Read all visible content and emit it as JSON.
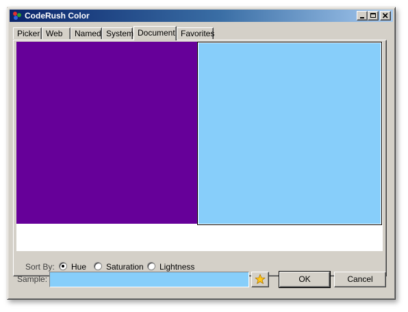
{
  "window": {
    "title": "CodeRush Color"
  },
  "tabs": [
    {
      "label": "Picker",
      "active": false
    },
    {
      "label": "Web",
      "active": false
    },
    {
      "label": "Named",
      "active": false
    },
    {
      "label": "System",
      "active": false
    },
    {
      "label": "Document",
      "active": true
    },
    {
      "label": "Favorites",
      "active": false
    }
  ],
  "swatches": [
    {
      "color": "#660099",
      "selected": false
    },
    {
      "color": "#87cefa",
      "selected": true
    }
  ],
  "sort": {
    "label": "Sort By:",
    "options": [
      {
        "label": "Hue",
        "checked": true
      },
      {
        "label": "Saturation",
        "checked": false
      },
      {
        "label": "Lightness",
        "checked": false
      }
    ]
  },
  "sample": {
    "label": "Sample:",
    "color": "#87cefa"
  },
  "icons": {
    "app": "color-drops-icon",
    "favorite": "star-icon"
  },
  "buttons": {
    "ok": "OK",
    "cancel": "Cancel"
  }
}
